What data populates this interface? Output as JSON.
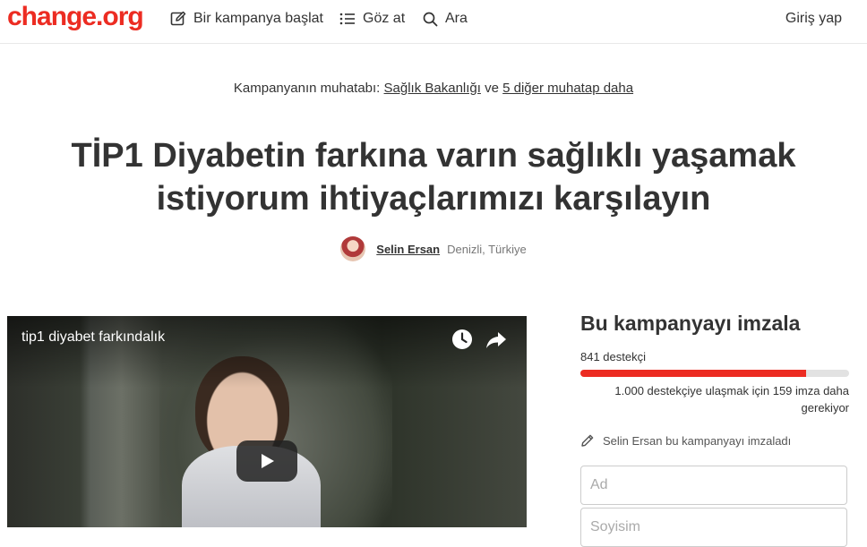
{
  "header": {
    "logo": "change.org",
    "start_campaign": "Bir kampanya başlat",
    "browse": "Göz at",
    "search": "Ara",
    "login": "Giriş yap"
  },
  "recipients": {
    "prefix": "Kampanyanın muhatabı:",
    "primary": "Sağlık Bakanlığı",
    "conjunction": "ve",
    "others": "5 diğer muhatap daha"
  },
  "petition": {
    "title": "TİP1 Diyabetin farkına varın sağlıklı yaşamak istiyorum ihtiyaçlarımızı karşılayın",
    "author_name": "Selin Ersan",
    "author_location": "Denizli, Türkiye"
  },
  "video": {
    "title": "tip1 diyabet farkındalık",
    "icons": [
      "watch-later-icon",
      "share-icon",
      "play-icon"
    ]
  },
  "sign": {
    "heading": "Bu kampanyayı imzala",
    "supporters": "841 destekçi",
    "progress": 0.841,
    "goal_text": "1.000 destekçiye ulaşmak için 159 imza daha gerekiyor",
    "recent_signer": "Selin Ersan bu kampanyayı imzaladı",
    "first_name_placeholder": "Ad",
    "last_name_placeholder": "Soyisim"
  },
  "colors": {
    "brand": "#ec2c22",
    "text": "#333333",
    "progress_track": "#e2e2e2"
  }
}
